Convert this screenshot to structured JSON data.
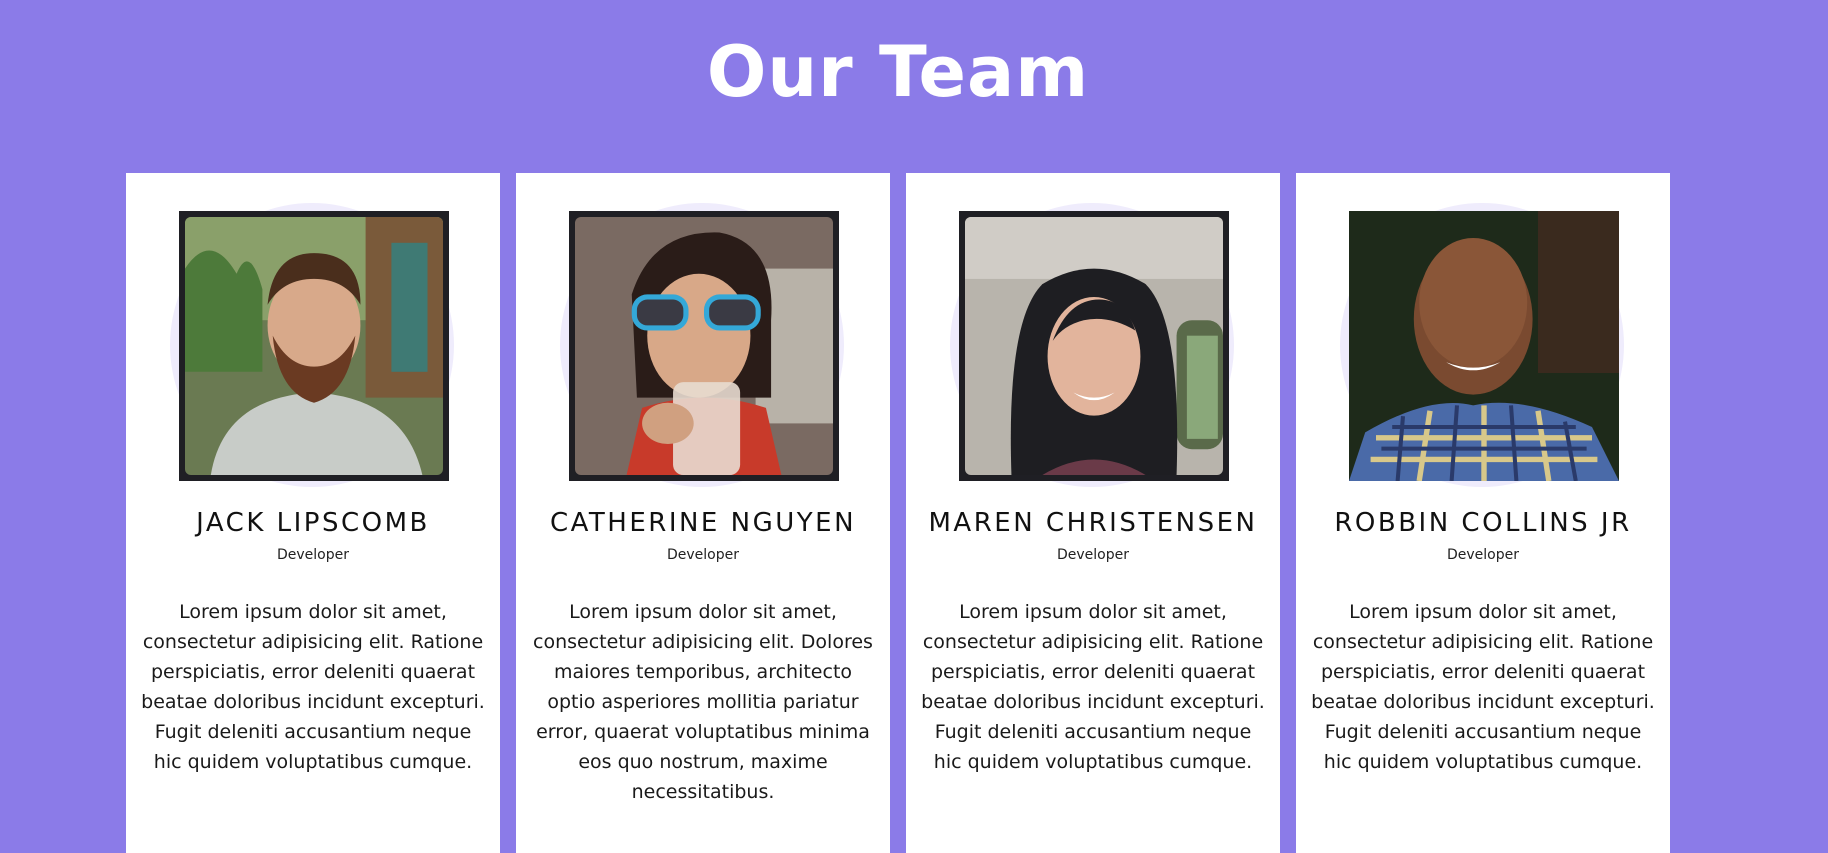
{
  "header": {
    "title": "Our Team"
  },
  "team": [
    {
      "name": "Jack Lipscomb",
      "role": "Developer",
      "bio": "Lorem ipsum dolor sit amet, consectetur adipisicing elit. Ratione perspiciatis, error deleniti quaerat beatae doloribus incidunt excepturi. Fugit deleniti accusantium neque hic quidem voluptatibus cumque."
    },
    {
      "name": "Catherine Nguyen",
      "role": "Developer",
      "bio": "Lorem ipsum dolor sit amet, consectetur adipisicing elit. Dolores maiores temporibus, architecto optio asperiores mollitia pariatur error, quaerat voluptatibus minima eos quo nostrum, maxime necessitatibus."
    },
    {
      "name": "Maren Christensen",
      "role": "Developer",
      "bio": "Lorem ipsum dolor sit amet, consectetur adipisicing elit. Ratione perspiciatis, error deleniti quaerat beatae doloribus incidunt excepturi. Fugit deleniti accusantium neque hic quidem voluptatibus cumque."
    },
    {
      "name": "Robbin Collins Jr",
      "role": "Developer",
      "bio": "Lorem ipsum dolor sit amet, consectetur adipisicing elit. Ratione perspiciatis, error deleniti quaerat beatae doloribus incidunt excepturi. Fugit deleniti accusantium neque hic quidem voluptatibus cumque."
    }
  ],
  "colors": {
    "background": "#8b7be8",
    "card": "#ffffff",
    "photo_frame": "#1f1f24",
    "halo": "#efecfc"
  }
}
